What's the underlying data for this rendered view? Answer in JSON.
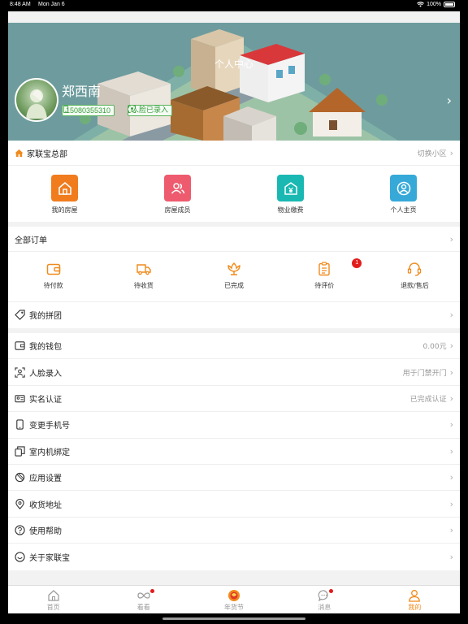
{
  "status_bar": {
    "time": "8:48 AM",
    "date": "Mon Jan 6",
    "battery": "100%"
  },
  "header": {
    "title": "个人中心",
    "username": "郑西南",
    "phone": "15080355310",
    "face_status": "人脸已录入"
  },
  "community": {
    "name": "家联宝总部",
    "switch_label": "切换小区",
    "items": [
      {
        "label": "我的房屋",
        "icon": "home-icon",
        "color": "#f07c1e"
      },
      {
        "label": "房屋成员",
        "icon": "members-icon",
        "color": "#ee5b6e"
      },
      {
        "label": "物业缴费",
        "icon": "payment-icon",
        "color": "#1ab8b2"
      },
      {
        "label": "个人主页",
        "icon": "profile-icon",
        "color": "#36a9d8"
      }
    ]
  },
  "orders": {
    "title": "全部订单",
    "items": [
      {
        "label": "待付款",
        "icon": "wallet-icon"
      },
      {
        "label": "待收货",
        "icon": "truck-icon"
      },
      {
        "label": "已完成",
        "icon": "flower-icon"
      },
      {
        "label": "待评价",
        "icon": "clipboard-icon",
        "badge": "1"
      },
      {
        "label": "退款/售后",
        "icon": "headset-icon"
      }
    ],
    "group_buy": "我的拼团"
  },
  "menu": [
    {
      "label": "我的钱包",
      "value": "0.00元",
      "icon": "wallet-icon"
    },
    {
      "label": "人脸录入",
      "value": "用于门禁开门",
      "icon": "face-scan-icon"
    },
    {
      "label": "实名认证",
      "value": "已完成认证",
      "icon": "id-card-icon"
    },
    {
      "label": "变更手机号",
      "value": "",
      "icon": "phone-icon"
    },
    {
      "label": "室内机绑定",
      "value": "",
      "icon": "device-icon"
    },
    {
      "label": "应用设置",
      "value": "",
      "icon": "settings-icon"
    },
    {
      "label": "收货地址",
      "value": "",
      "icon": "location-icon"
    },
    {
      "label": "使用帮助",
      "value": "",
      "icon": "help-icon"
    },
    {
      "label": "关于家联宝",
      "value": "",
      "icon": "smile-icon"
    }
  ],
  "tabbar": [
    {
      "label": "首页",
      "icon": "home-tab-icon"
    },
    {
      "label": "看看",
      "icon": "infinity-icon"
    },
    {
      "label": "年货节",
      "icon": "festival-icon"
    },
    {
      "label": "消息",
      "icon": "message-icon"
    },
    {
      "label": "我的",
      "icon": "me-icon"
    }
  ],
  "colors": {
    "accent": "#f08a1c",
    "green_badge": "#3a9e3d",
    "red_dot": "#e21b1b"
  }
}
